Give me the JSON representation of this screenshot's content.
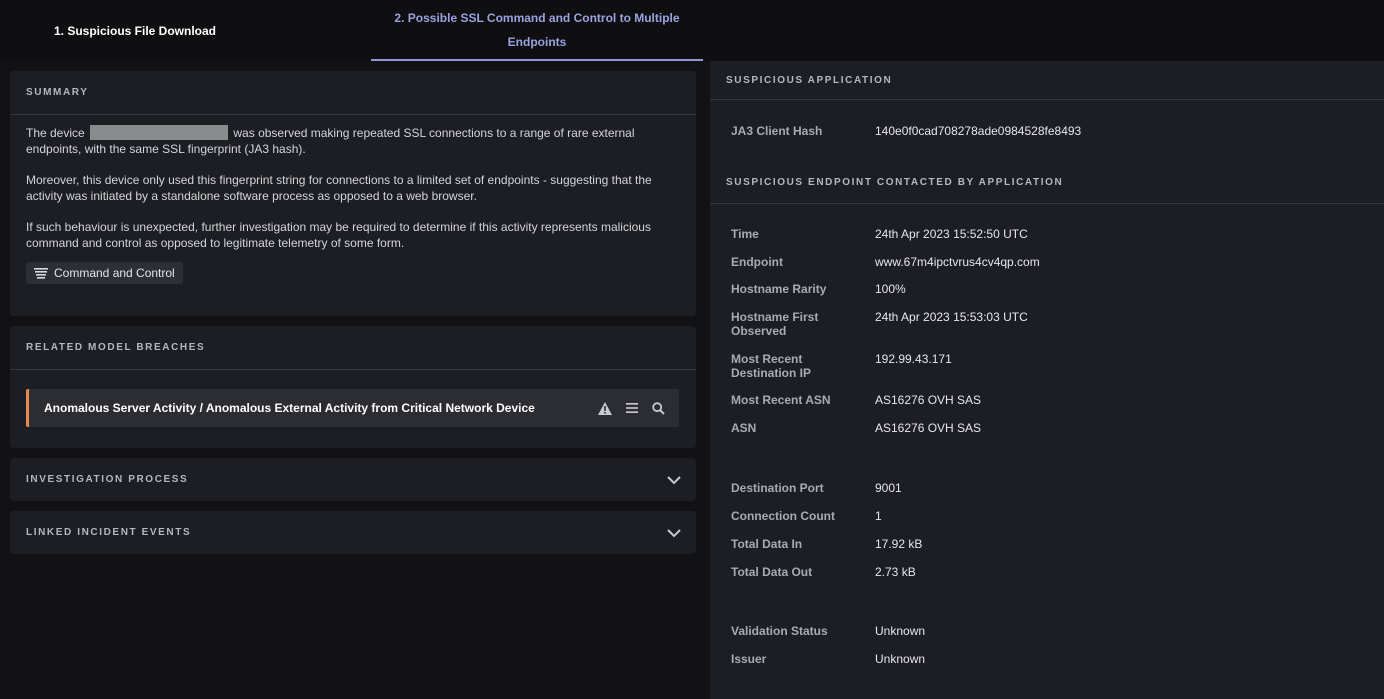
{
  "tabs": [
    {
      "label": "1. Suspicious File Download"
    },
    {
      "label": "2. Possible SSL Command and Control to Multiple Endpoints"
    }
  ],
  "summary": {
    "header": "Summary",
    "para1_before": "The device",
    "para1_after": "was observed making repeated SSL connections to a range of rare external endpoints, with the same SSL fingerprint (JA3 hash).",
    "para2": "Moreover, this device only used this fingerprint string for connections to a limited set of endpoints - suggesting that the activity was initiated by a standalone software process as opposed to a web browser.",
    "para3": "If such behaviour is unexpected, further investigation may be required to determine if this activity represents malicious command and control as opposed to legitimate telemetry of some form.",
    "tag_label": "Command and Control"
  },
  "related": {
    "header": "Related Model Breaches",
    "breach": "Anomalous Server Activity / Anomalous External Activity from Critical Network Device"
  },
  "investigation": {
    "header": "Investigation Process"
  },
  "linked": {
    "header": "Linked Incident Events"
  },
  "application": {
    "header": "Suspicious Application",
    "ja3_label": "JA3 Client Hash",
    "ja3_value": "140e0f0cad708278ade0984528fe8493"
  },
  "endpoint": {
    "header": "Suspicious Endpoint Contacted by Application",
    "fields": [
      {
        "label": "Time",
        "value": "24th Apr 2023 15:52:50 UTC"
      },
      {
        "label": "Endpoint",
        "value": "www.67m4ipctvrus4cv4qp.com"
      },
      {
        "label": "Hostname Rarity",
        "value": "100%"
      },
      {
        "label": "Hostname First Observed",
        "value": "24th Apr 2023 15:53:03 UTC"
      },
      {
        "label": "Most Recent Destination IP",
        "value": "192.99.43.171"
      },
      {
        "label": "Most Recent ASN",
        "value": "AS16276 OVH SAS"
      },
      {
        "label": "ASN",
        "value": "AS16276 OVH SAS"
      },
      {
        "label": "Destination Port",
        "value": "9001"
      },
      {
        "label": "Connection Count",
        "value": "1"
      },
      {
        "label": "Total Data In",
        "value": "17.92 kB"
      },
      {
        "label": "Total Data Out",
        "value": "2.73 kB"
      },
      {
        "label": "Validation Status",
        "value": "Unknown"
      },
      {
        "label": "Issuer",
        "value": "Unknown"
      }
    ]
  },
  "colors": {
    "accent": "#9aa3df",
    "breach_bar": "#e8884b"
  }
}
